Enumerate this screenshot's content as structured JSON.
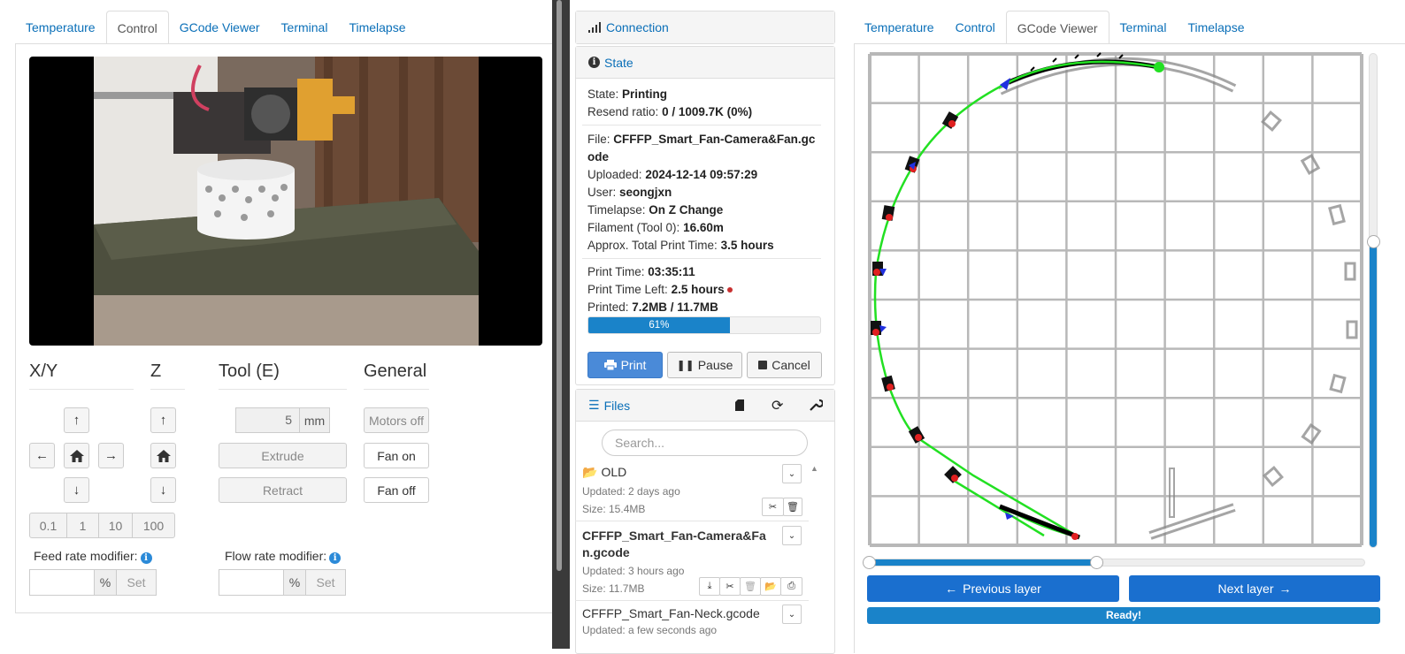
{
  "left": {
    "tabs": [
      "Temperature",
      "Control",
      "GCode Viewer",
      "Terminal",
      "Timelapse"
    ],
    "active_tab": "Control",
    "sections": {
      "xy": "X/Y",
      "z": "Z",
      "tool": "Tool (E)",
      "general": "General"
    },
    "jog_steps": [
      "0.1",
      "1",
      "10",
      "100"
    ],
    "tool": {
      "amount": "5",
      "unit": "mm",
      "extrude": "Extrude",
      "retract": "Retract"
    },
    "general": {
      "motors_off": "Motors off",
      "fan_on": "Fan on",
      "fan_off": "Fan off"
    },
    "feed_rate": {
      "label": "Feed rate modifier:",
      "unit": "%",
      "set": "Set"
    },
    "flow_rate": {
      "label": "Flow rate modifier:",
      "unit": "%",
      "set": "Set"
    }
  },
  "mid": {
    "connection_title": "Connection",
    "state_title": "State",
    "state": {
      "label": "State:",
      "value": "Printing"
    },
    "resend": {
      "label": "Resend ratio:",
      "value": "0 / 1009.7K (0%)"
    },
    "file": {
      "label": "File:",
      "value": "CFFFP_Smart_Fan-Camera&Fan.gcode"
    },
    "uploaded": {
      "label": "Uploaded:",
      "value": "2024-12-14 09:57:29"
    },
    "user": {
      "label": "User:",
      "value": "seongjxn"
    },
    "timelapse": {
      "label": "Timelapse:",
      "value": "On Z Change"
    },
    "filament": {
      "label": "Filament (Tool 0):",
      "value": "16.60m"
    },
    "approx": {
      "label": "Approx. Total Print Time:",
      "value": "3.5 hours"
    },
    "print_time": {
      "label": "Print Time:",
      "value": "03:35:11"
    },
    "print_time_left": {
      "label": "Print Time Left:",
      "value": "2.5 hours"
    },
    "printed": {
      "label": "Printed:",
      "value": "7.2MB / 11.7MB"
    },
    "progress": {
      "percent": 61,
      "label": "61%"
    },
    "buttons": {
      "print": "Print",
      "pause": "Pause",
      "cancel": "Cancel"
    },
    "files_title": "Files",
    "search_placeholder": "Search...",
    "files": [
      {
        "name": "OLD",
        "updated": "Updated: 2 days ago",
        "size": "Size: 15.4MB"
      },
      {
        "name": "CFFFP_Smart_Fan-Camera&Fan.gcode",
        "updated": "Updated: 3 hours ago",
        "size": "Size: 11.7MB"
      },
      {
        "name": "CFFFP_Smart_Fan-Neck.gcode",
        "updated": "Updated: a few seconds ago"
      }
    ]
  },
  "right": {
    "tabs": [
      "Temperature",
      "Control",
      "GCode Viewer",
      "Terminal",
      "Timelapse"
    ],
    "active_tab": "GCode Viewer",
    "layer_slider_fraction": 0.46,
    "z_slider_fraction": 0.62,
    "prev_layer": "Previous layer",
    "next_layer": "Next layer",
    "status": "Ready!"
  },
  "colors": {
    "accent": "#1a83c9",
    "link": "#0a6fb8",
    "toolpath": "#22e022",
    "primary_btn": "#4a8ad8"
  }
}
